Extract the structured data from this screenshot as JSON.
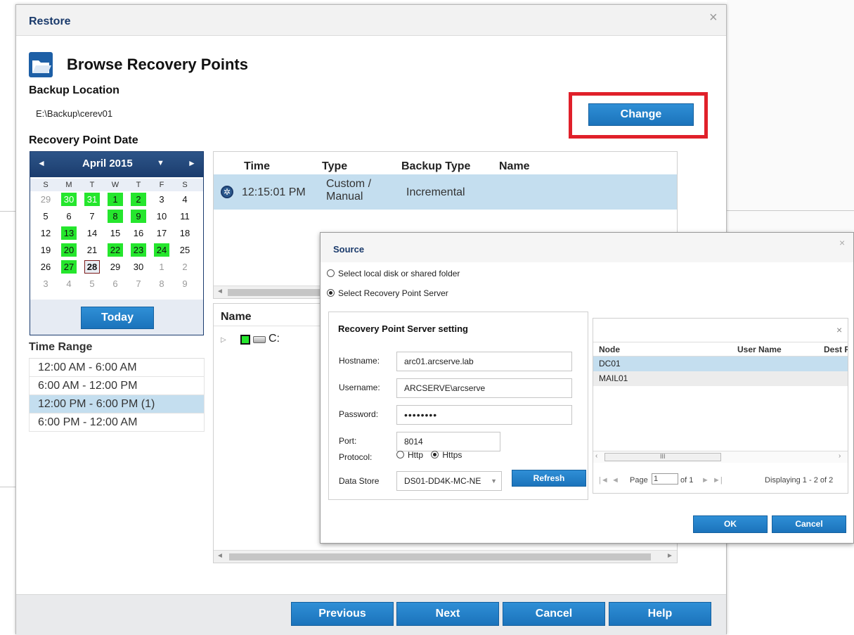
{
  "restore": {
    "title": "Restore",
    "close_icon": "×",
    "page_title": "Browse Recovery Points",
    "backup_location_label": "Backup Location",
    "backup_location_value": "E:\\Backup\\cerev01",
    "change_label": "Change",
    "recovery_point_date_label": "Recovery Point Date"
  },
  "calendar": {
    "month": "April 2015",
    "prev_icon": "◄",
    "next_icon": "►",
    "dropdown_icon": "▼",
    "days_of_week": [
      "S",
      "M",
      "T",
      "W",
      "T",
      "F",
      "S"
    ],
    "weeks": [
      [
        {
          "d": "29",
          "o": true
        },
        {
          "d": "30",
          "o": true,
          "b": true
        },
        {
          "d": "31",
          "o": true,
          "b": true
        },
        {
          "d": "1",
          "b": true
        },
        {
          "d": "2",
          "b": true
        },
        {
          "d": "3"
        },
        {
          "d": "4"
        }
      ],
      [
        {
          "d": "5"
        },
        {
          "d": "6"
        },
        {
          "d": "7"
        },
        {
          "d": "8",
          "b": true
        },
        {
          "d": "9",
          "b": true
        },
        {
          "d": "10"
        },
        {
          "d": "11"
        }
      ],
      [
        {
          "d": "12"
        },
        {
          "d": "13",
          "b": true
        },
        {
          "d": "14"
        },
        {
          "d": "15"
        },
        {
          "d": "16"
        },
        {
          "d": "17"
        },
        {
          "d": "18"
        }
      ],
      [
        {
          "d": "19"
        },
        {
          "d": "20",
          "b": true
        },
        {
          "d": "21"
        },
        {
          "d": "22",
          "b": true
        },
        {
          "d": "23",
          "b": true
        },
        {
          "d": "24",
          "b": true
        },
        {
          "d": "25"
        }
      ],
      [
        {
          "d": "26"
        },
        {
          "d": "27",
          "b": true
        },
        {
          "d": "28",
          "s": true
        },
        {
          "d": "29"
        },
        {
          "d": "30"
        },
        {
          "d": "1",
          "o": true
        },
        {
          "d": "2",
          "o": true
        }
      ],
      [
        {
          "d": "3",
          "o": true
        },
        {
          "d": "4",
          "o": true
        },
        {
          "d": "5",
          "o": true
        },
        {
          "d": "6",
          "o": true
        },
        {
          "d": "7",
          "o": true
        },
        {
          "d": "8",
          "o": true
        },
        {
          "d": "9",
          "o": true
        }
      ]
    ],
    "today_label": "Today"
  },
  "time_range": {
    "label": "Time Range",
    "items": [
      "12:00 AM - 6:00 AM",
      "6:00 AM - 12:00 PM",
      "12:00 PM - 6:00 PM  (1)",
      "6:00 PM - 12:00 AM"
    ],
    "selected_index": 2
  },
  "recovery_points": {
    "columns": [
      "Time",
      "Type",
      "Backup Type",
      "Name"
    ],
    "rows": [
      {
        "time": "12:15:01 PM",
        "type_line1": "Custom /",
        "type_line2": "Manual",
        "backup_type": "Incremental",
        "name": ""
      }
    ]
  },
  "files": {
    "name_column": "Name",
    "tree": [
      {
        "label": "C:"
      }
    ],
    "toggle_icon": "▷"
  },
  "footer": {
    "previous": "Previous",
    "next": "Next",
    "cancel": "Cancel",
    "help": "Help"
  },
  "source": {
    "title": "Source",
    "close_icon": "×",
    "option_local": "Select local disk or shared folder",
    "option_rps": "Select Recovery Point Server",
    "selected_option": "rps",
    "panel_title": "Recovery Point Server setting",
    "hostname_label": "Hostname:",
    "hostname_value": "arc01.arcserve.lab",
    "username_label": "Username:",
    "username_value": "ARCSERVE\\arcserve",
    "password_label": "Password:",
    "password_mask": "••••••••",
    "port_label": "Port:",
    "port_value": "8014",
    "protocol_label": "Protocol:",
    "protocol_http": "Http",
    "protocol_https": "Https",
    "protocol_selected": "Https",
    "datastore_label": "Data Store",
    "datastore_value": "DS01-DD4K-MC-NE",
    "refresh_label": "Refresh",
    "ok_label": "OK",
    "cancel_label": "Cancel"
  },
  "nodes": {
    "search_clear_icon": "×",
    "columns": [
      "Node",
      "User Name",
      "Dest P"
    ],
    "rows": [
      "DC01",
      "MAIL01"
    ],
    "selected_index": 0,
    "scroll_center": "III",
    "pager": {
      "page_label": "Page",
      "page_value": "1",
      "of_label": "of 1",
      "displaying": "Displaying 1 - 2 of 2",
      "first_icon": "|◄",
      "prev_icon": "◄",
      "next_icon": "►",
      "last_icon": "►|"
    }
  }
}
